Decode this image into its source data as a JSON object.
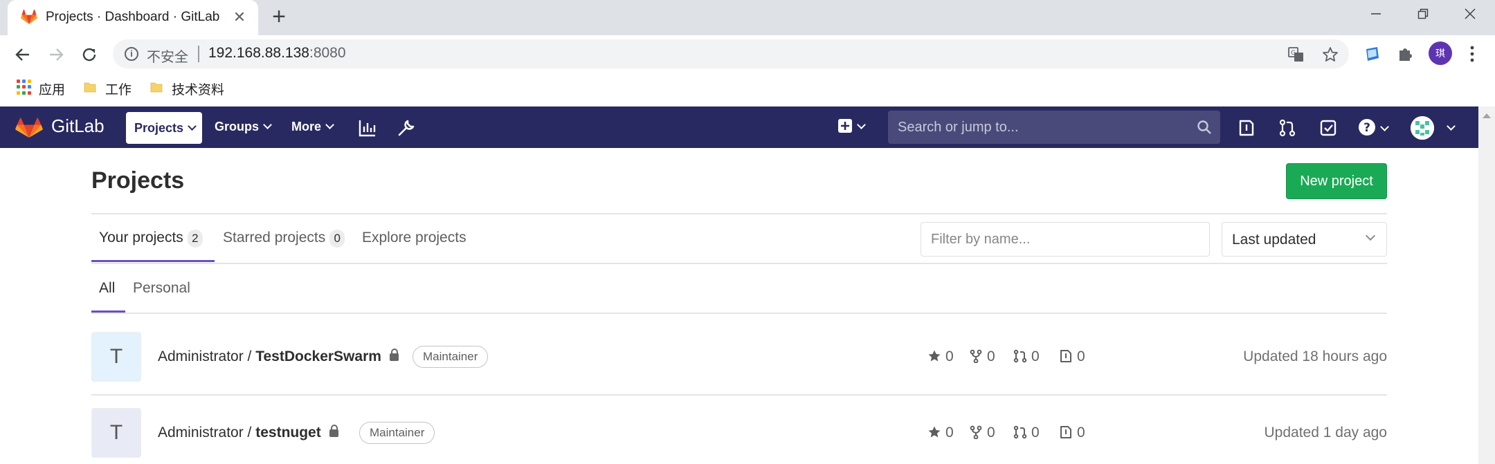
{
  "browser": {
    "tab_title": "Projects · Dashboard · GitLab",
    "close_symbol": "✕",
    "new_tab_symbol": "+",
    "security_label": "不安全",
    "url_host": "192.168.88.138",
    "url_port": ":8080",
    "profile_initial": "琪",
    "bookmarks": [
      "应用",
      "工作",
      "技术资料"
    ]
  },
  "navbar": {
    "brand": "GitLab",
    "projects": "Projects",
    "groups": "Groups",
    "more": "More",
    "search_placeholder": "Search or jump to..."
  },
  "page": {
    "title": "Projects",
    "new_project": "New project",
    "tabs": [
      {
        "label": "Your projects",
        "count": "2"
      },
      {
        "label": "Starred projects",
        "count": "0"
      },
      {
        "label": "Explore projects"
      }
    ],
    "filter_placeholder": "Filter by name...",
    "sort_value": "Last updated",
    "subtabs": [
      "All",
      "Personal"
    ]
  },
  "projects": [
    {
      "avatar": "T",
      "namespace": "Administrator / ",
      "name": "TestDockerSwarm",
      "role": "Maintainer",
      "stars": "0",
      "forks": "0",
      "merge_requests": "0",
      "issues": "0",
      "updated": "Updated 18 hours ago"
    },
    {
      "avatar": "T",
      "namespace": "Administrator / ",
      "name": "testnuget",
      "role": "Maintainer",
      "stars": "0",
      "forks": "0",
      "merge_requests": "0",
      "issues": "0",
      "updated": "Updated 1 day ago"
    }
  ],
  "colors": {
    "navbar_bg": "#292961",
    "new_project_bg": "#1aaa55",
    "active_tab_underline": "#6b4fbb",
    "avatar_1_bg": "#e3f2fd",
    "avatar_2_bg": "#e8eaf6"
  }
}
